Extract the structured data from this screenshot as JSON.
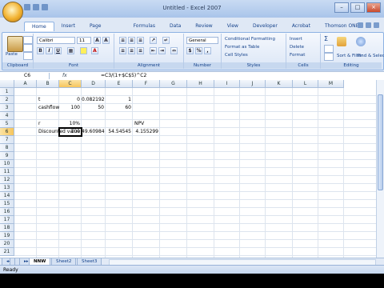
{
  "window": {
    "title": "Untitled - Excel 2007"
  },
  "ribbon": {
    "tabs": [
      "Home",
      "Insert",
      "Page Layout",
      "Formulas",
      "Data",
      "Review",
      "View",
      "Developer",
      "Acrobat",
      "Thomson ONE Banker"
    ],
    "clipboard": {
      "paste_label": "Paste",
      "group_label": "Clipboard"
    },
    "font": {
      "font_name": "Calibri",
      "font_size": "11",
      "bold": "B",
      "italic": "I",
      "underline": "U",
      "group_label": "Font"
    },
    "alignment": {
      "group_label": "Alignment"
    },
    "number": {
      "format": "General",
      "currency": "$",
      "percent": "%",
      "comma": ",",
      "group_label": "Number"
    },
    "styles": {
      "conditional": "Conditional Formatting",
      "format_table": "Format as Table",
      "cell_styles": "Cell Styles",
      "group_label": "Styles"
    },
    "cells": {
      "insert": "Insert",
      "delete": "Delete",
      "format": "Format",
      "group_label": "Cells"
    },
    "editing": {
      "sum": "Σ",
      "sort_filter": "Sort & Filter",
      "find_select": "Find & Select",
      "group_label": "Editing"
    }
  },
  "formula_bar": {
    "name_box": "C6",
    "fx": "fx",
    "formula": "=C3/(1+$C$5)^C2"
  },
  "grid": {
    "columns": [
      "A",
      "B",
      "C",
      "D",
      "E",
      "F",
      "G",
      "H",
      "I",
      "J",
      "K",
      "L",
      "M"
    ],
    "rows": [
      "1",
      "2",
      "3",
      "4",
      "5",
      "6",
      "7",
      "8",
      "9",
      "10",
      "11",
      "12",
      "13",
      "14",
      "15",
      "16",
      "17",
      "18",
      "19",
      "20",
      "21"
    ],
    "cells": {
      "B2": "t",
      "C2": "0",
      "D2": "0.082192",
      "E2": "1",
      "B3": "cashflow",
      "C3": "100",
      "D3": "50",
      "E3": "60",
      "B5": "r",
      "C5": "10%",
      "F5": "NPV",
      "B6": "Discounted value",
      "C6": "100",
      "D6": "49.60984",
      "E6": "54.54545",
      "F6": "4.155299"
    }
  },
  "sheets": [
    "NNW",
    "Sheet2",
    "Sheet3"
  ],
  "status": {
    "ready": "Ready"
  }
}
